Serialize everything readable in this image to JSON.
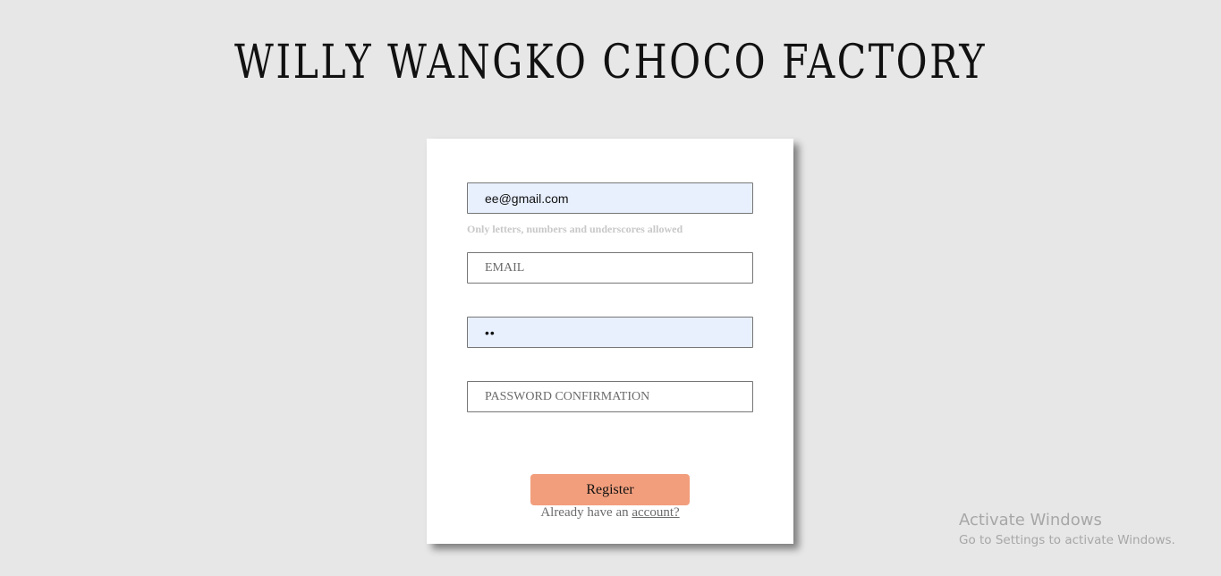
{
  "header": {
    "title": "WILLY WANGKO CHOCO FACTORY"
  },
  "form": {
    "username": {
      "value": "ee@gmail.com",
      "hint": "Only letters, numbers and underscores allowed"
    },
    "email": {
      "value": "",
      "placeholder": "EMAIL"
    },
    "password": {
      "value": "••"
    },
    "password_confirmation": {
      "value": "",
      "placeholder": "PASSWORD CONFIRMATION"
    },
    "register_label": "Register",
    "login_prompt": "Already have an ",
    "login_link": "account?"
  },
  "watermark": {
    "title": "Activate Windows",
    "subtitle": "Go to Settings to activate Windows."
  },
  "colors": {
    "background": "#e7e7e7",
    "card": "#ffffff",
    "button": "#f29e7c",
    "autofill": "#e8f0fe"
  }
}
